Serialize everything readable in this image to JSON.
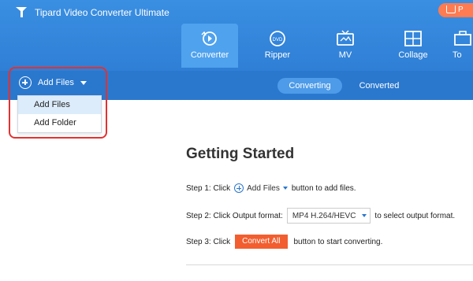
{
  "app": {
    "title": "Tipard Video Converter Ultimate",
    "buy_label": "P"
  },
  "nav": {
    "tabs": [
      {
        "label": "Converter",
        "icon": "converter-icon",
        "active": true
      },
      {
        "label": "Ripper",
        "icon": "dvd-icon"
      },
      {
        "label": "MV",
        "icon": "tv-icon"
      },
      {
        "label": "Collage",
        "icon": "collage-icon"
      },
      {
        "label": "To",
        "icon": "toolbox-icon"
      }
    ]
  },
  "subbar": {
    "add_files_label": "Add Files",
    "segments": [
      "Converting",
      "Converted"
    ]
  },
  "dropdown": {
    "items": [
      "Add Files",
      "Add Folder"
    ]
  },
  "main": {
    "heading": "Getting Started",
    "step1": {
      "prefix": "Step 1: Click",
      "button": "Add Files",
      "suffix": "button to add files."
    },
    "step2": {
      "prefix": "Step 2: Click Output format:",
      "format": "MP4 H.264/HEVC",
      "suffix": "to select output format."
    },
    "step3": {
      "prefix": "Step 3: Click",
      "button": "Convert All",
      "suffix": "button to start converting."
    }
  },
  "colors": {
    "header": "#2f7fd6",
    "accent": "#f25e2f",
    "highlight_box": "#e53030"
  }
}
